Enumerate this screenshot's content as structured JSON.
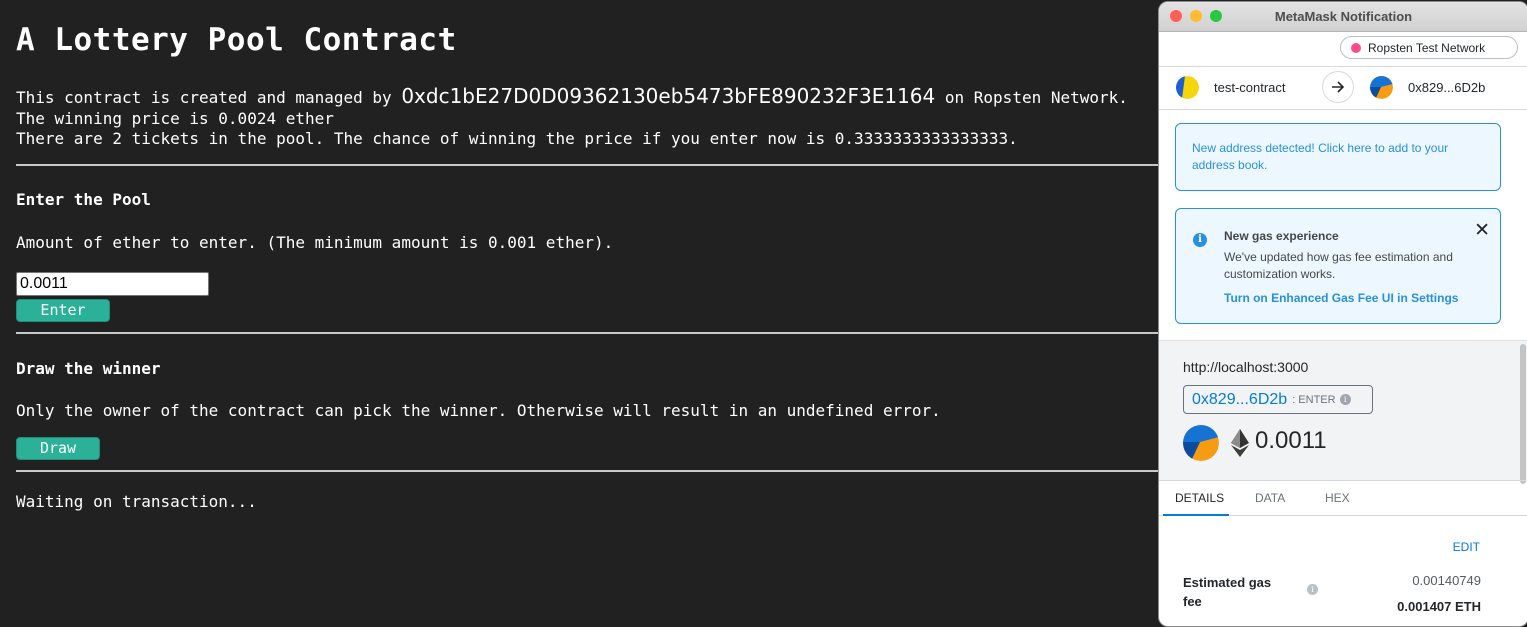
{
  "page": {
    "title": "A Lottery Pool Contract",
    "intro_prefix": "This contract is created and managed by ",
    "manager_address": "0xdc1bE27D0D09362130eb5473bFE890232F3E1164",
    "intro_suffix": " on Ropsten Network.",
    "winning_price_line": "The winning price is 0.0024 ether",
    "tickets_line": "There are 2 tickets in the pool. The chance of winning the price if you enter now is 0.3333333333333333.",
    "enter_section": {
      "heading": "Enter the Pool",
      "description": "Amount of ether to enter. (The minimum amount is 0.001 ether).",
      "input_value": "0.0011",
      "button_label": "Enter"
    },
    "draw_section": {
      "heading": "Draw the winner",
      "description": "Only the owner of the contract can pick the winner. Otherwise will result in an undefined error.",
      "button_label": "Draw"
    },
    "status": "Waiting on transaction..."
  },
  "metamask": {
    "window_title": "MetaMask Notification",
    "traffic_lights": {
      "close": "#ff5f57",
      "minimize": "#febc2e",
      "maximize": "#28c840"
    },
    "network": "Ropsten Test Network",
    "from_account": "test-contract",
    "to_account": "0x829...6D2b",
    "address_alert": "New address detected! Click here to add to your address book.",
    "gas_alert": {
      "title": "New gas experience",
      "body": "We've updated how gas fee estimation and customization works.",
      "link": "Turn on Enhanced Gas Fee UI in Settings",
      "close_icon": "close-icon"
    },
    "origin": "http://localhost:3000",
    "method_address": "0x829...6D2b",
    "method_name": ": ENTER",
    "value": "0.0011",
    "tabs": [
      "DETAILS",
      "DATA",
      "HEX"
    ],
    "edit_label": "EDIT",
    "gas_fee_label": "Estimated gas fee",
    "gas_fee_value": "0.00140749",
    "gas_fee_eth": "0.001407 ETH",
    "accent_color": "#037dd6"
  }
}
